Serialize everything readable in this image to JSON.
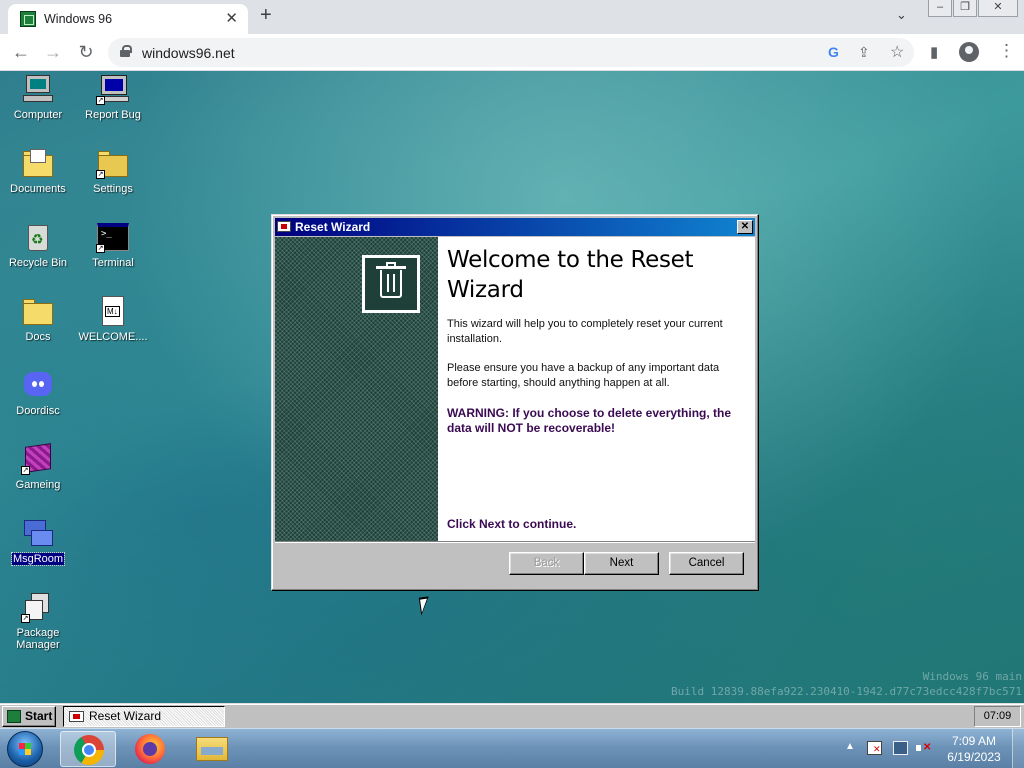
{
  "browser": {
    "tab_title": "Windows 96",
    "tab_close": "✕",
    "new_tab": "+",
    "tab_dropdown": "⌄",
    "url": "windows96.net",
    "window_controls": {
      "minimize": "–",
      "restore": "❐",
      "close": "✕"
    },
    "nav": {
      "back": "←",
      "forward": "→",
      "reload": "↻"
    },
    "omnibox_icons": {
      "google": "G",
      "share": "⇪",
      "bookmark": "☆"
    },
    "toolbar_icons": {
      "side_panel": "▮",
      "menu": "⋮"
    }
  },
  "desktop": {
    "icons": [
      {
        "label": "Computer"
      },
      {
        "label": "Report Bug"
      },
      {
        "label": "Documents"
      },
      {
        "label": "Settings"
      },
      {
        "label": "Recycle Bin"
      },
      {
        "label": "Terminal"
      },
      {
        "label": "Docs"
      },
      {
        "label": "WELCOME...."
      },
      {
        "label": "Doordisc"
      },
      {
        "label": "Gameing"
      },
      {
        "label": "MsgRoom"
      },
      {
        "label": "Package Manager"
      }
    ],
    "build_line1": "Windows 96 main",
    "build_line2": "Build 12839.88efa922.230410-1942.d77c73edcc428f7bc571"
  },
  "wizard": {
    "title": "Reset Wizard",
    "close_glyph": "✕",
    "heading": "Welcome to the Reset Wizard",
    "para1": "This wizard will help you to completely reset your current installation.",
    "para2": "Please ensure you have a backup of any important data before starting, should anything happen at all.",
    "warning": "WARNING: If you choose to delete everything, the data will NOT be recoverable!",
    "continue_text": "Click Next to continue.",
    "buttons": {
      "back": "Back",
      "next": "Next",
      "cancel": "Cancel"
    }
  },
  "taskbar": {
    "start_label": "Start",
    "task_item_label": "Reset Wizard",
    "clock": "07:09"
  },
  "host_taskbar": {
    "time": "7:09 AM",
    "date": "6/19/2023",
    "tray_arrow": "▲"
  }
}
